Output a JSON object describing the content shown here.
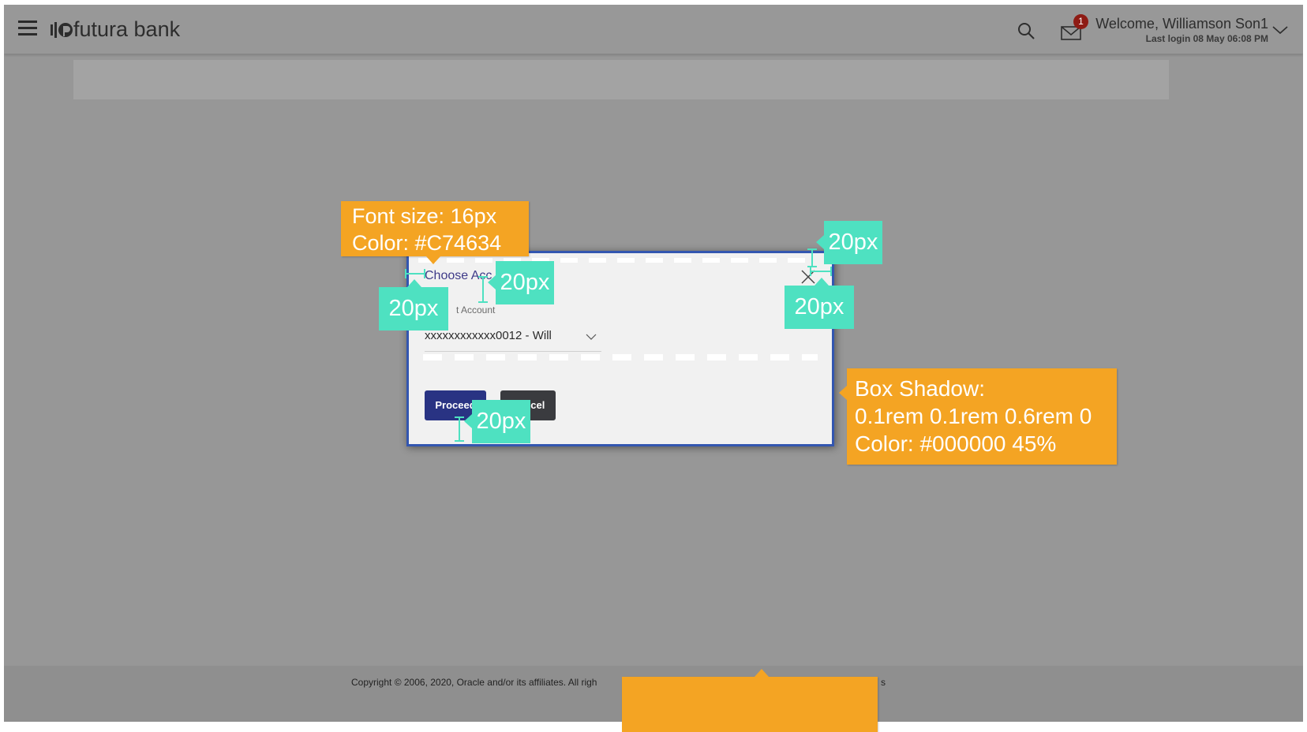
{
  "header": {
    "brand": "futura bank",
    "welcome": "Welcome, Williamson Son1",
    "last_login": "Last login 08 May 06:08 PM",
    "mail_badge_count": "1"
  },
  "modal": {
    "title": "Choose Acc",
    "field_label": "t Account",
    "account_value": "xxxxxxxxxxxx0012 - Will",
    "proceed_label": "Proceed",
    "cancel_label": "Cancel"
  },
  "footer": {
    "copyright": "Copyright © 2006, 2020, Oracle and/or its affiliates. All righ",
    "copyright_tail": "s"
  },
  "annotations": {
    "font_note_line1": "Font size: 16px",
    "font_note_line2": "Color: #C74634",
    "shadow_note_line1": "Box Shadow:",
    "shadow_note_line2": "0.1rem 0.1rem 0.6rem 0",
    "shadow_note_line3": "Color: #000000 45%",
    "spacing_label": "20px"
  },
  "colors": {
    "overlay": "#979797",
    "primary_button": "#293383",
    "secondary_button": "#3a3b3f",
    "modal_border": "#3356b0",
    "annotation_orange": "#f4a423",
    "annotation_teal": "#4ee1c1",
    "badge": "#8e1b14"
  },
  "icons": [
    "hamburger-icon",
    "futura-logo-icon",
    "search-icon",
    "mail-icon",
    "chevron-down-icon",
    "close-icon"
  ]
}
